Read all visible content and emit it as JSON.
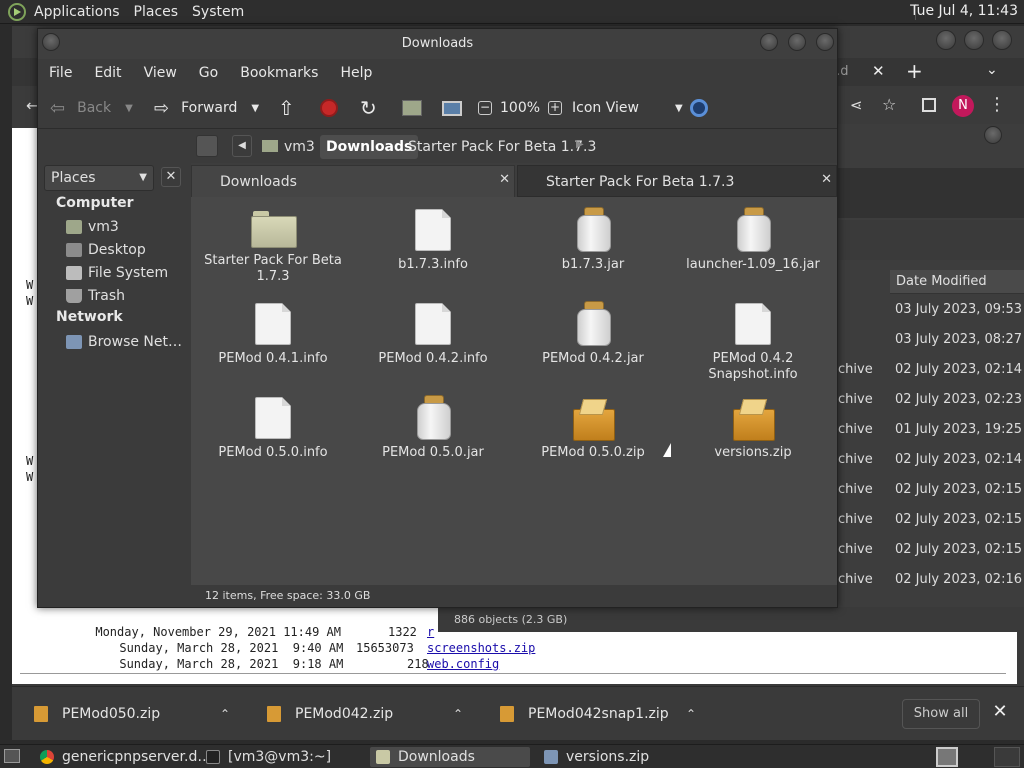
{
  "top_panel": {
    "menus": [
      "Applications",
      "Places",
      "System"
    ],
    "clock": "Tue Jul 4, 11:43"
  },
  "browser": {
    "tab_fragment": "er.d",
    "listing_rows": [
      {
        "date": "Monday, November 29, 2021 11:49 AM",
        "size": "1322",
        "name": "r"
      },
      {
        "date": "Sunday, March 28, 2021  9:40 AM",
        "size": "15653073",
        "name": "screenshots.zip"
      },
      {
        "date": "Sunday, March 28, 2021  9:18 AM",
        "size": "218",
        "name": "web.config"
      }
    ],
    "left_letters": [
      "W",
      "W",
      "W",
      "W"
    ]
  },
  "archive_window": {
    "column_date": "Date Modified",
    "rows": [
      {
        "kind": "",
        "date": "03 July 2023, 09:53"
      },
      {
        "kind": "",
        "date": "03 July 2023, 08:27"
      },
      {
        "kind": "chive",
        "date": "02 July 2023, 02:14"
      },
      {
        "kind": "chive",
        "date": "02 July 2023, 02:23"
      },
      {
        "kind": "chive",
        "date": "01 July 2023, 19:25"
      },
      {
        "kind": "chive",
        "date": "02 July 2023, 02:14"
      },
      {
        "kind": "chive",
        "date": "02 July 2023, 02:15"
      },
      {
        "kind": "chive",
        "date": "02 July 2023, 02:15"
      },
      {
        "kind": "chive",
        "date": "02 July 2023, 02:15"
      },
      {
        "kind": "chive",
        "date": "02 July 2023, 02:16"
      }
    ],
    "status": "886 objects (2.3 GB)"
  },
  "nautilus": {
    "title": "Downloads",
    "menus": [
      "File",
      "Edit",
      "View",
      "Go",
      "Bookmarks",
      "Help"
    ],
    "toolbar": {
      "back": "Back",
      "forward": "Forward",
      "zoom": "100%",
      "view_mode": "Icon View"
    },
    "breadcrumbs": [
      "vm3",
      "Downloads",
      "Starter Pack For Beta 1.7.3"
    ],
    "sidebar": {
      "selector": "Places",
      "computer_head": "Computer",
      "computer_items": [
        "vm3",
        "Desktop",
        "File System",
        "Trash"
      ],
      "network_head": "Network",
      "network_items": [
        "Browse Net…"
      ]
    },
    "tabs": [
      "Downloads",
      "Starter Pack For Beta 1.7.3"
    ],
    "files": [
      {
        "name": "Starter Pack For Beta 1.7.3",
        "icon": "folder-icon"
      },
      {
        "name": "b1.7.3.info",
        "icon": "text-file-icon"
      },
      {
        "name": "b1.7.3.jar",
        "icon": "jar-icon"
      },
      {
        "name": "launcher-1.09_16.jar",
        "icon": "jar-icon"
      },
      {
        "name": "PEMod 0.4.1.info",
        "icon": "text-file-icon"
      },
      {
        "name": "PEMod 0.4.2.info",
        "icon": "text-file-icon"
      },
      {
        "name": "PEMod 0.4.2.jar",
        "icon": "jar-icon"
      },
      {
        "name": "PEMod 0.4.2 Snapshot.info",
        "icon": "text-file-icon"
      },
      {
        "name": "PEMod 0.5.0.info",
        "icon": "text-file-icon"
      },
      {
        "name": "PEMod 0.5.0.jar",
        "icon": "jar-icon"
      },
      {
        "name": "PEMod 0.5.0.zip",
        "icon": "zip-icon"
      },
      {
        "name": "versions.zip",
        "icon": "zip-icon"
      }
    ],
    "status": "12 items, Free space: 33.0 GB"
  },
  "downloads_shelf": {
    "items": [
      "PEMod050.zip",
      "PEMod042.zip",
      "PEMod042snap1.zip"
    ],
    "show_all": "Show all"
  },
  "taskbar": {
    "tasks": [
      "genericpnpserver.d…",
      "[vm3@vm3:~]",
      "Downloads",
      "versions.zip"
    ]
  }
}
